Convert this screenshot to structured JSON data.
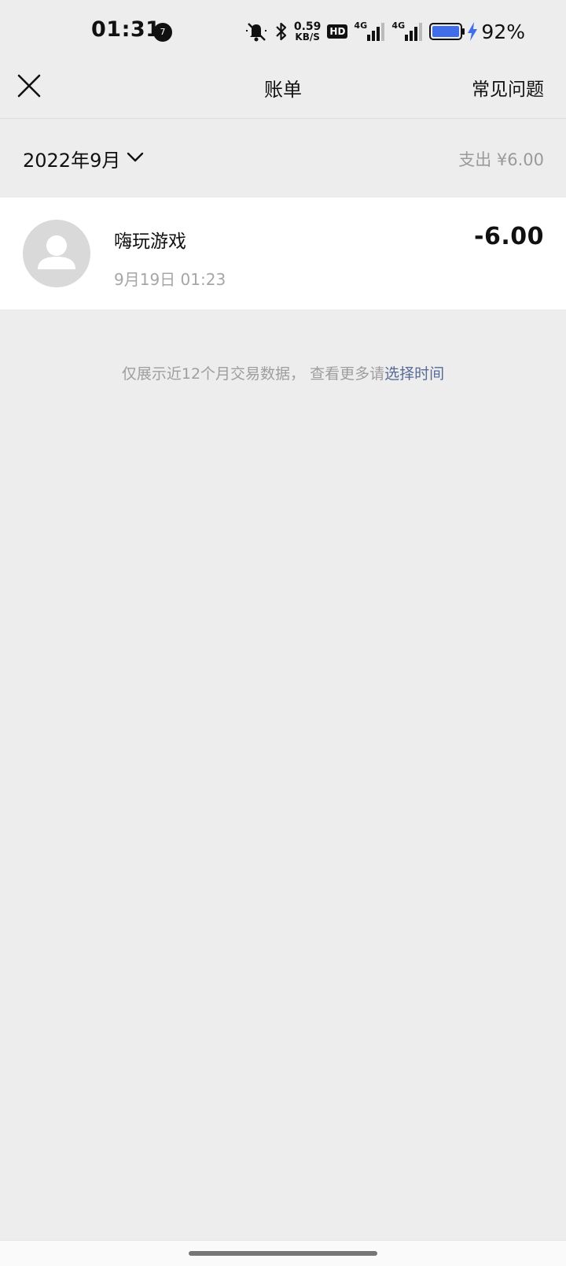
{
  "status_bar": {
    "time": "01:31",
    "notification_count": "7",
    "net_speed_value": "0.59",
    "net_speed_unit": "KB/S",
    "hd_label": "HD",
    "signal1_label": "4G",
    "signal2_label": "4G",
    "battery_percent": "92%",
    "colors": {
      "battery_fill": "#3f6ee8",
      "charging": "#3f6ee8"
    }
  },
  "nav": {
    "title": "账单",
    "faq_label": "常见问题",
    "close_icon": "close-icon"
  },
  "month": {
    "label": "2022年9月",
    "summary": "支出 ¥6.00",
    "dropdown_icon": "chevron-down-icon"
  },
  "transactions": [
    {
      "name": "嗨玩游戏",
      "time": "9月19日 01:23",
      "amount": "-6.00",
      "avatar_icon": "user-avatar-icon"
    }
  ],
  "footer": {
    "note_prefix": "仅展示近12个月交易数据， 查看更多请",
    "note_link": "选择时间",
    "link_color": "#576b95"
  }
}
